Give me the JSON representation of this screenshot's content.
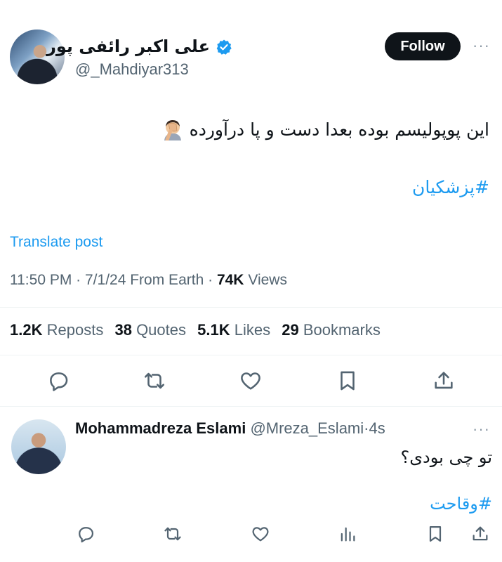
{
  "tweet": {
    "author_name": "علی اکبر رائفی پور",
    "handle": "@_Mahdiyar313",
    "follow_label": "Follow",
    "more_label": "···",
    "text": "این پوپولیسم بوده بعدا دست و پا درآورده",
    "hashtag": "#پزشکیان",
    "translate_label": "Translate post",
    "time": "11:50 PM",
    "date": "7/1/24",
    "source": "From Earth",
    "views_count": "74K",
    "views_label": "Views",
    "stats": {
      "reposts_count": "1.2K",
      "reposts_label": "Reposts",
      "quotes_count": "38",
      "quotes_label": "Quotes",
      "likes_count": "5.1K",
      "likes_label": "Likes",
      "bookmarks_count": "29",
      "bookmarks_label": "Bookmarks"
    }
  },
  "reply": {
    "author_name": "Mohammadreza Eslami",
    "handle": "@Mreza_Eslami",
    "time": "4s",
    "more_label": "···",
    "text": "تو چی بودی؟",
    "hashtag": "#وقاحت"
  },
  "icons": {
    "verified": "verified-badge-icon",
    "reply": "reply-icon",
    "repost": "repost-icon",
    "like": "like-icon",
    "bookmark": "bookmark-icon",
    "share": "share-icon",
    "views": "views-icon"
  },
  "colors": {
    "accent": "#1d9bf0",
    "text": "#0f1419",
    "muted": "#536471",
    "icon": "#536471",
    "divider": "#eff3f4"
  }
}
